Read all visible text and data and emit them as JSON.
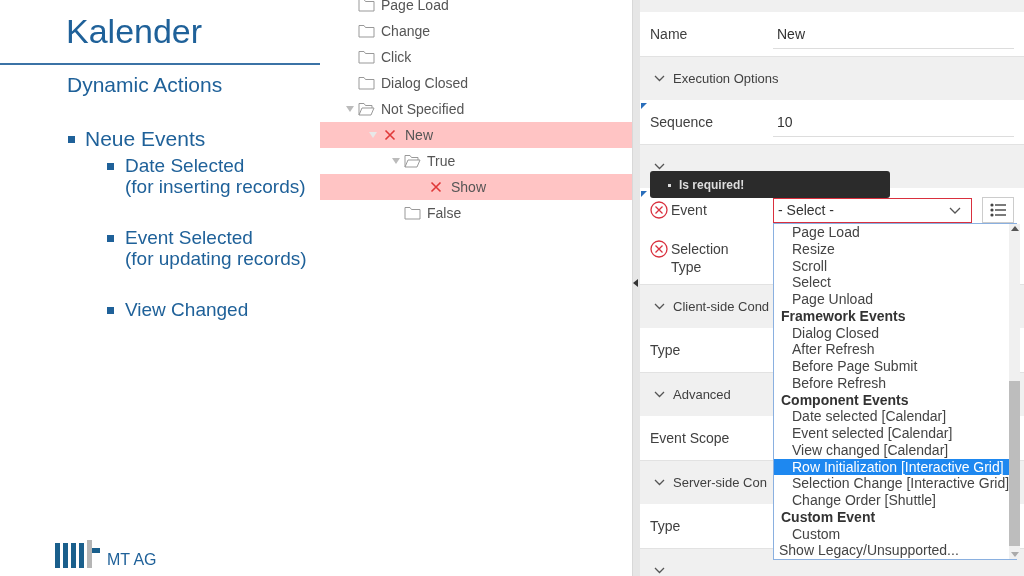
{
  "slide": {
    "title": "Kalender",
    "subtitle": "Dynamic Actions",
    "bullets": [
      {
        "text": "Neue Events",
        "children": [
          {
            "lines": [
              "Date Selected",
              "(for inserting records)"
            ]
          },
          {
            "lines": [
              "Event Selected",
              "(for updating records)"
            ]
          },
          {
            "lines": [
              "View Changed"
            ]
          }
        ]
      }
    ],
    "logo_text": "MT AG"
  },
  "tree": [
    {
      "label": "Page Load",
      "invalid": false,
      "expanded": false
    },
    {
      "label": "Change",
      "invalid": false,
      "expanded": false
    },
    {
      "label": "Click",
      "invalid": false,
      "expanded": false
    },
    {
      "label": "Dialog Closed",
      "invalid": false,
      "expanded": false
    },
    {
      "label": "Not Specified",
      "invalid": false,
      "expanded": true,
      "children": [
        {
          "label": "New",
          "invalid": true,
          "expanded": true,
          "children": [
            {
              "label": "True",
              "invalid": false,
              "expanded": true,
              "children": [
                {
                  "label": "Show",
                  "invalid": true
                }
              ]
            },
            {
              "label": "False",
              "invalid": false,
              "expanded": false
            }
          ]
        }
      ]
    }
  ],
  "properties": [
    {
      "kind": "field",
      "label": "Name",
      "value": "New",
      "modified": false,
      "error": false
    },
    {
      "kind": "header",
      "title": "Execution Options"
    },
    {
      "kind": "field",
      "label": "Sequence",
      "value": "10",
      "modified": true,
      "error": false
    },
    {
      "kind": "header"
    },
    {
      "kind": "select",
      "label": "Event",
      "value": "- Select -",
      "modified": true,
      "error": true
    },
    {
      "kind": "label",
      "label": "Selection Type",
      "modified": false,
      "error": true
    },
    {
      "kind": "header",
      "title": "Client-side Cond"
    },
    {
      "kind": "label",
      "label": "Type",
      "modified": false,
      "error": false
    },
    {
      "kind": "header",
      "title": "Advanced"
    },
    {
      "kind": "label",
      "label": "Event Scope",
      "modified": false,
      "error": false
    },
    {
      "kind": "header",
      "title": "Server-side Con"
    },
    {
      "kind": "label",
      "label": "Type",
      "modified": false,
      "error": false
    },
    {
      "kind": "header"
    }
  ],
  "tooltip": {
    "messages": [
      "Is required!"
    ]
  },
  "dropdown": [
    {
      "kind": "option",
      "label": "Page Load",
      "selected": false
    },
    {
      "kind": "option",
      "label": "Resize",
      "selected": false
    },
    {
      "kind": "option",
      "label": "Scroll",
      "selected": false
    },
    {
      "kind": "option",
      "label": "Select",
      "selected": false
    },
    {
      "kind": "option",
      "label": "Page Unload",
      "selected": false
    },
    {
      "kind": "group",
      "label": "Framework Events",
      "selected": false
    },
    {
      "kind": "option",
      "label": "Dialog Closed",
      "selected": false
    },
    {
      "kind": "option",
      "label": "After Refresh",
      "selected": false
    },
    {
      "kind": "option",
      "label": "Before Page Submit",
      "selected": false
    },
    {
      "kind": "option",
      "label": "Before Refresh",
      "selected": false
    },
    {
      "kind": "group",
      "label": "Component Events",
      "selected": false
    },
    {
      "kind": "option",
      "label": "Date selected [Calendar]",
      "selected": false
    },
    {
      "kind": "option",
      "label": "Event selected [Calendar]",
      "selected": false
    },
    {
      "kind": "option",
      "label": "View changed [Calendar]",
      "selected": false
    },
    {
      "kind": "option",
      "label": "Row Initialization [Interactive Grid]",
      "selected": true
    },
    {
      "kind": "option",
      "label": "Selection Change [Interactive Grid]",
      "selected": false
    },
    {
      "kind": "option",
      "label": "Change Order [Shuttle]",
      "selected": false
    },
    {
      "kind": "group",
      "label": "Custom Event",
      "selected": false
    },
    {
      "kind": "option",
      "label": "Custom",
      "selected": false
    },
    {
      "kind": "action",
      "label": "Show Legacy/Unsupported...",
      "selected": false
    }
  ]
}
